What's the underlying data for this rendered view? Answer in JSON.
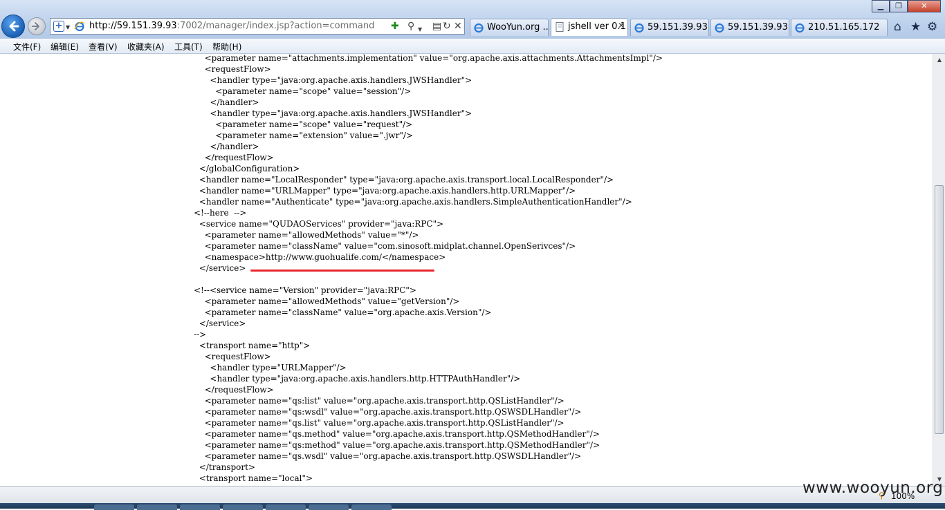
{
  "browser": {
    "url_host": "http://59.151.39.93",
    "url_rest": ":7002/manager/index.jsp?action=command",
    "tabs": [
      {
        "label": "WooYun.org ..."
      },
      {
        "label": "jshell ver 0.1",
        "active": true
      },
      {
        "label": "59.151.39.93"
      },
      {
        "label": "59.151.39.93"
      },
      {
        "label": "210.51.165.172"
      }
    ],
    "menu": [
      "文件(F)",
      "编辑(E)",
      "查看(V)",
      "收藏夹(A)",
      "工具(T)",
      "帮助(H)"
    ],
    "zoom": "100%",
    "watermark": "www.wooyun.org"
  },
  "content": {
    "lines": [
      "  <parameter name=\"attachments.implementation\" value=\"org.apache.axis.attachments.AttachmentsImpl\"/>",
      "  <requestFlow>",
      "   <handler type=\"java:org.apache.axis.handlers.JWSHandler\">",
      "    <parameter name=\"scope\" value=\"session\"/>",
      "   </handler>",
      "   <handler type=\"java:org.apache.axis.handlers.JWSHandler\">",
      "    <parameter name=\"scope\" value=\"request\"/>",
      "    <parameter name=\"extension\" value=\".jwr\"/>",
      "   </handler>",
      "  </requestFlow>",
      " </globalConfiguration>",
      " <handler name=\"LocalResponder\" type=\"java:org.apache.axis.transport.local.LocalResponder\"/>",
      " <handler name=\"URLMapper\" type=\"java:org.apache.axis.handlers.http.URLMapper\"/>",
      " <handler name=\"Authenticate\" type=\"java:org.apache.axis.handlers.SimpleAuthenticationHandler\"/>",
      "<!--here  -->",
      " <service name=\"QUDAOServices\" provider=\"java:RPC\">",
      "  <parameter name=\"allowedMethods\" value=\"*\"/>",
      "  <parameter name=\"className\" value=\"com.sinosoft.midplat.channel.OpenSerivces\"/>",
      "  <namespace>http://www.guohualife.com/</namespace>",
      " </service>",
      "",
      "<!--<service name=\"Version\" provider=\"java:RPC\">",
      "  <parameter name=\"allowedMethods\" value=\"getVersion\"/>",
      "  <parameter name=\"className\" value=\"org.apache.axis.Version\"/>",
      " </service>",
      "-->",
      " <transport name=\"http\">",
      "  <requestFlow>",
      "   <handler type=\"URLMapper\"/>",
      "   <handler type=\"java:org.apache.axis.handlers.http.HTTPAuthHandler\"/>",
      "  </requestFlow>",
      "  <parameter name=\"qs:list\" value=\"org.apache.axis.transport.http.QSListHandler\"/>",
      "  <parameter name=\"qs:wsdl\" value=\"org.apache.axis.transport.http.QSWSDLHandler\"/>",
      "  <parameter name=\"qs.list\" value=\"org.apache.axis.transport.http.QSListHandler\"/>",
      "  <parameter name=\"qs.method\" value=\"org.apache.axis.transport.http.QSMethodHandler\"/>",
      "  <parameter name=\"qs:method\" value=\"org.apache.axis.transport.http.QSMethodHandler\"/>",
      "  <parameter name=\"qs.wsdl\" value=\"org.apache.axis.transport.http.QSWSDLHandler\"/>",
      " </transport>",
      " <transport name=\"local\">"
    ]
  }
}
